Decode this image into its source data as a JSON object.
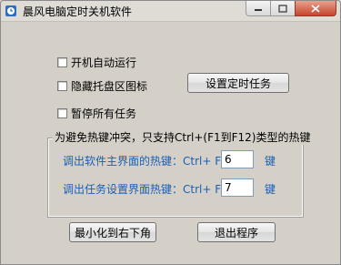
{
  "window": {
    "title": "晨风电脑定时关机软件"
  },
  "options": {
    "autostart_label": "开机自动运行",
    "hide_tray_label": "隐藏托盘区图标",
    "pause_all_label": "暂停所有任务"
  },
  "buttons": {
    "set_task": "设置定时任务",
    "minimize_corner": "最小化到右下角",
    "exit": "退出程序"
  },
  "hotkeys": {
    "caption": "为避免热键冲突，只支持Ctrl+(F1到F12)类型的热键",
    "main_label": "调出软件主界面的热键：Ctrl+ F",
    "main_value": "6",
    "task_label": "调出任务设置界面热键：Ctrl+ F",
    "task_value": "7",
    "suffix": "键"
  },
  "colors": {
    "accent_blue": "#1a5fb4",
    "face": "#d4d0c8"
  }
}
